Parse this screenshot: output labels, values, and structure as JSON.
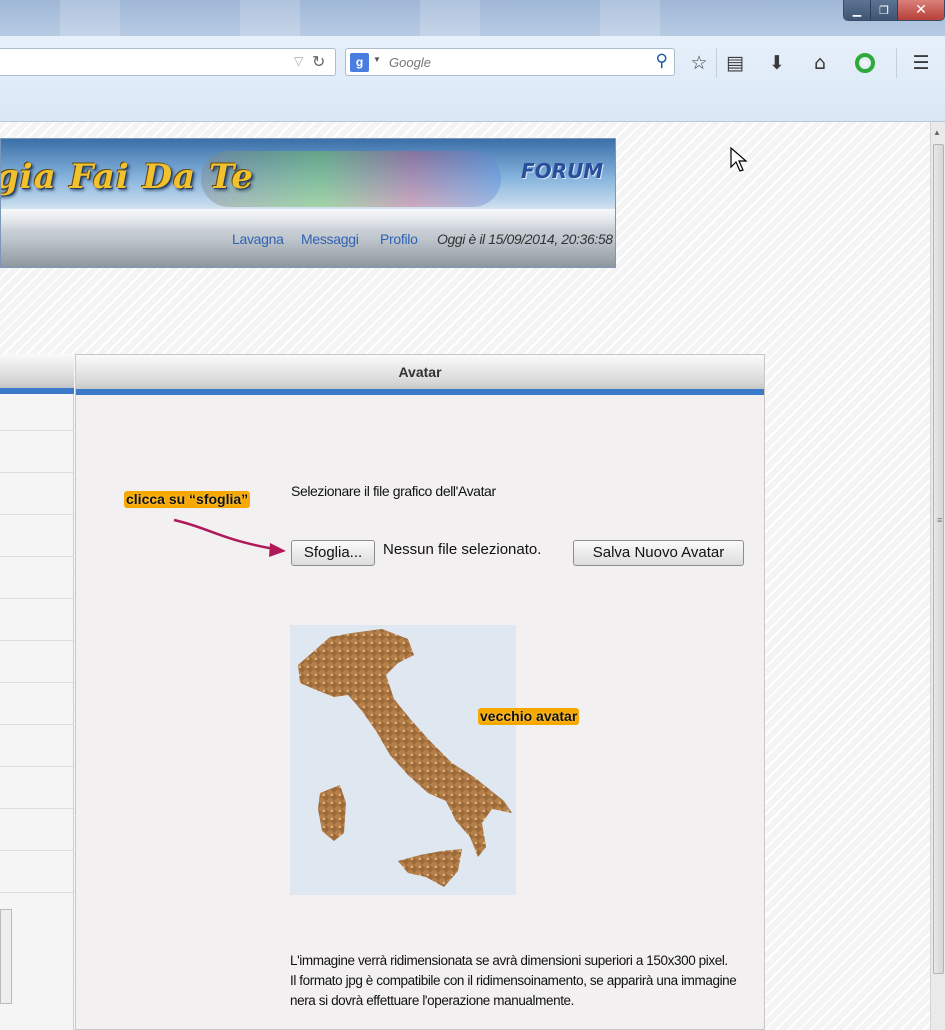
{
  "window": {
    "minimize_glyph": "▁",
    "restore_glyph": "❐",
    "close_glyph": "✕"
  },
  "toolbar": {
    "search_placeholder": "Google",
    "search_engine_letter": "g",
    "icons": [
      "bookmark-star-icon",
      "reading-list-icon",
      "download-icon",
      "home-icon",
      "addon-icon",
      "menu-icon"
    ]
  },
  "banner": {
    "logo_text": "gia Fai Da Te",
    "forum_label": "FORUM",
    "nav_links": [
      "Lavagna",
      "Messaggi",
      "Profilo"
    ],
    "datetime": "Oggi è il 15/09/2014, 20:36:58"
  },
  "panel": {
    "title": "Avatar",
    "prompt": "Selezionare il file grafico dell'Avatar",
    "browse_button": "Sfoglia...",
    "no_file_text": "Nessun file selezionato.",
    "save_button": "Salva Nuovo Avatar",
    "note_lines": [
      "L'immagine verrà ridimensionata se avrà dimensioni superiori a 150x300 pixel.",
      "Il formato jpg è compatibile con il ridimensoinamento, se apparirà una immagine",
      "nera si dovrà effettuare l'operazione manualmente."
    ]
  },
  "annotations": {
    "browse_hint": "clicca su “sfoglia”",
    "old_avatar": "vecchio avatar"
  },
  "colors": {
    "accent_blue": "#3a7ac8",
    "callout_orange": "#f7a800",
    "arrow_magenta": "#b0185a",
    "avatar_bg": "#dfe8f1",
    "avatar_map": "#b5804a"
  }
}
